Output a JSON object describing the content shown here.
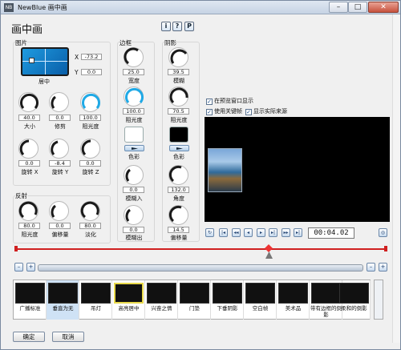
{
  "window": {
    "title": "NewBlue 画中画",
    "app_icon": "NB"
  },
  "page_title": "画中画",
  "toolbar": {
    "info": "i",
    "help": "?",
    "preset": "P"
  },
  "picture": {
    "group_label": "图片",
    "pad_label": "居中",
    "x_label": "X",
    "x_value": "-73.2",
    "y_label": "Y",
    "y_value": "0.0",
    "size_label": "大小",
    "size_value": "40.0",
    "crop_label": "修剪",
    "crop_value": "0.0",
    "opacity_label": "阻光度",
    "opacity_value": "100.0",
    "rotx_label": "旋转 X",
    "rotx_value": "0.0",
    "roty_label": "旋转 Y",
    "roty_value": "-8.4",
    "rotz_label": "旋转 Z",
    "rotz_value": "0.0"
  },
  "reflection": {
    "group_label": "反射",
    "opacity_label": "阻光度",
    "opacity_value": "80.0",
    "offset_label": "偏移量",
    "offset_value": "0.0",
    "fade_label": "淡化",
    "fade_value": "80.0"
  },
  "border": {
    "group_label": "边框",
    "width_label": "宽度",
    "width_value": "25.0",
    "opacity_label": "阻光度",
    "opacity_value": "100.0",
    "color_label": "色彩",
    "color": "#ffffff",
    "fadein_label": "模糊入",
    "fadein_value": "0.0",
    "fadeout_label": "模糊出",
    "fadeout_value": "0.0"
  },
  "shadow": {
    "group_label": "阴影",
    "blur_label": "模糊",
    "blur_value": "39.5",
    "opacity_label": "阻光度",
    "opacity_value": "70.5",
    "color_label": "色彩",
    "color": "#000000",
    "angle_label": "角度",
    "angle_value": "132.0",
    "offset_label": "偏移量",
    "offset_value": "14.5"
  },
  "options": {
    "show_in_preview": "在预览窗口显示",
    "use_keyframes": "使用关键帧",
    "show_source": "显示实际来源"
  },
  "transport": {
    "timecode": "00:04.02"
  },
  "presets": [
    "广播标准",
    "垂直为无",
    "吊灯",
    "高亮居中",
    "兴奋之情",
    "门垫",
    "下垂阴影",
    "空白帧",
    "美术品",
    "带有边框的倒影",
    "柔和的倒影"
  ],
  "footer": {
    "ok": "确定",
    "cancel": "取消"
  },
  "colors": {
    "accent": "#1fa9e6",
    "timeline": "#d02020"
  }
}
